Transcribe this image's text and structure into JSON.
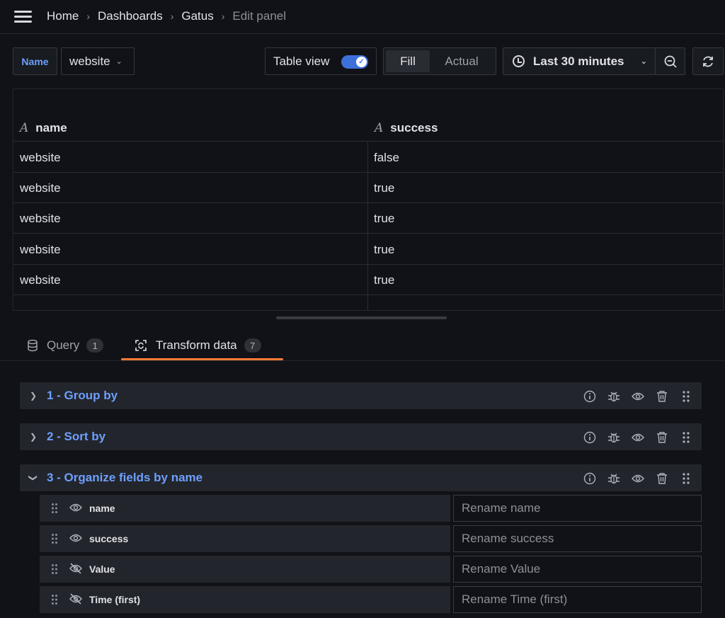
{
  "breadcrumb": {
    "items": [
      "Home",
      "Dashboards",
      "Gatus"
    ],
    "current": "Edit panel",
    "separator": "›"
  },
  "toolbar": {
    "variable_label": "Name",
    "variable_value": "website",
    "table_view_label": "Table view",
    "table_view_enabled": true,
    "fill_label": "Fill",
    "actual_label": "Actual",
    "time_range": "Last 30 minutes"
  },
  "table": {
    "columns": [
      "name",
      "success"
    ],
    "type_glyph": "A",
    "rows": [
      [
        "website",
        "false"
      ],
      [
        "website",
        "true"
      ],
      [
        "website",
        "true"
      ],
      [
        "website",
        "true"
      ],
      [
        "website",
        "true"
      ]
    ]
  },
  "tabs": {
    "query_label": "Query",
    "query_count": "1",
    "transform_label": "Transform data",
    "transform_count": "7"
  },
  "transformations": [
    {
      "title": "1 - Group by",
      "expanded": false
    },
    {
      "title": "2 - Sort by",
      "expanded": false
    },
    {
      "title": "3 - Organize fields by name",
      "expanded": true
    }
  ],
  "organize_fields": [
    {
      "name": "name",
      "visible": true,
      "placeholder": "Rename name"
    },
    {
      "name": "success",
      "visible": true,
      "placeholder": "Rename success"
    },
    {
      "name": "Value",
      "visible": false,
      "placeholder": "Rename Value"
    },
    {
      "name": "Time (first)",
      "visible": false,
      "placeholder": "Rename Time (first)"
    }
  ],
  "colors": {
    "accent_blue": "#6e9fff",
    "tab_underline": "#ff7a36",
    "toggle_on": "#3d71d9"
  }
}
